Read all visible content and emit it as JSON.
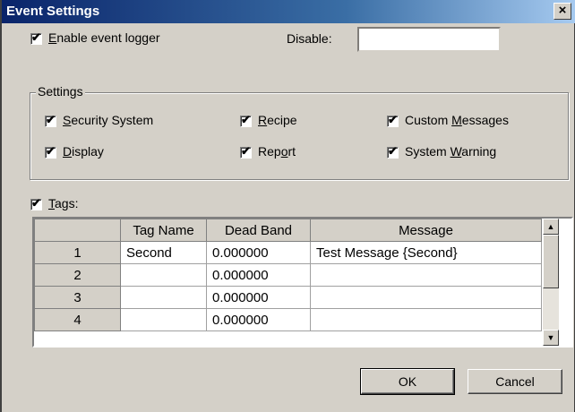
{
  "window": {
    "title": "Event Settings",
    "close_glyph": "×"
  },
  "logger": {
    "enable_label_pre": "",
    "enable_label_key": "E",
    "enable_label_post": "nable event logger",
    "enable_checked": true
  },
  "disable": {
    "label": "Disable:",
    "value": ""
  },
  "settings": {
    "group_label": "Settings",
    "items": [
      {
        "key": "S",
        "rest": "ecurity System",
        "checked": true
      },
      {
        "key": "R",
        "rest": "ecipe",
        "checked": true
      },
      {
        "pre": "Custom ",
        "key": "M",
        "rest": "essages",
        "checked": true
      },
      {
        "key": "D",
        "rest": "isplay",
        "checked": true
      },
      {
        "pre": "Rep",
        "key": "o",
        "rest": "rt",
        "checked": true
      },
      {
        "pre": "System ",
        "key": "W",
        "rest": "arning",
        "checked": true
      }
    ]
  },
  "tags": {
    "label_key": "T",
    "label_rest": "ags:",
    "checked": true,
    "columns": [
      "",
      "Tag Name",
      "Dead Band",
      "Message"
    ],
    "rows": [
      {
        "num": "1",
        "tag": "Second",
        "deadband": "0.000000",
        "message": "Test Message {Second}"
      },
      {
        "num": "2",
        "tag": "",
        "deadband": "0.000000",
        "message": ""
      },
      {
        "num": "3",
        "tag": "",
        "deadband": "0.000000",
        "message": ""
      },
      {
        "num": "4",
        "tag": "",
        "deadband": "0.000000",
        "message": ""
      }
    ]
  },
  "buttons": {
    "ok": "OK",
    "cancel": "Cancel"
  },
  "icons": {
    "check": "✔",
    "scroll_up": "▲",
    "scroll_down": "▼"
  }
}
